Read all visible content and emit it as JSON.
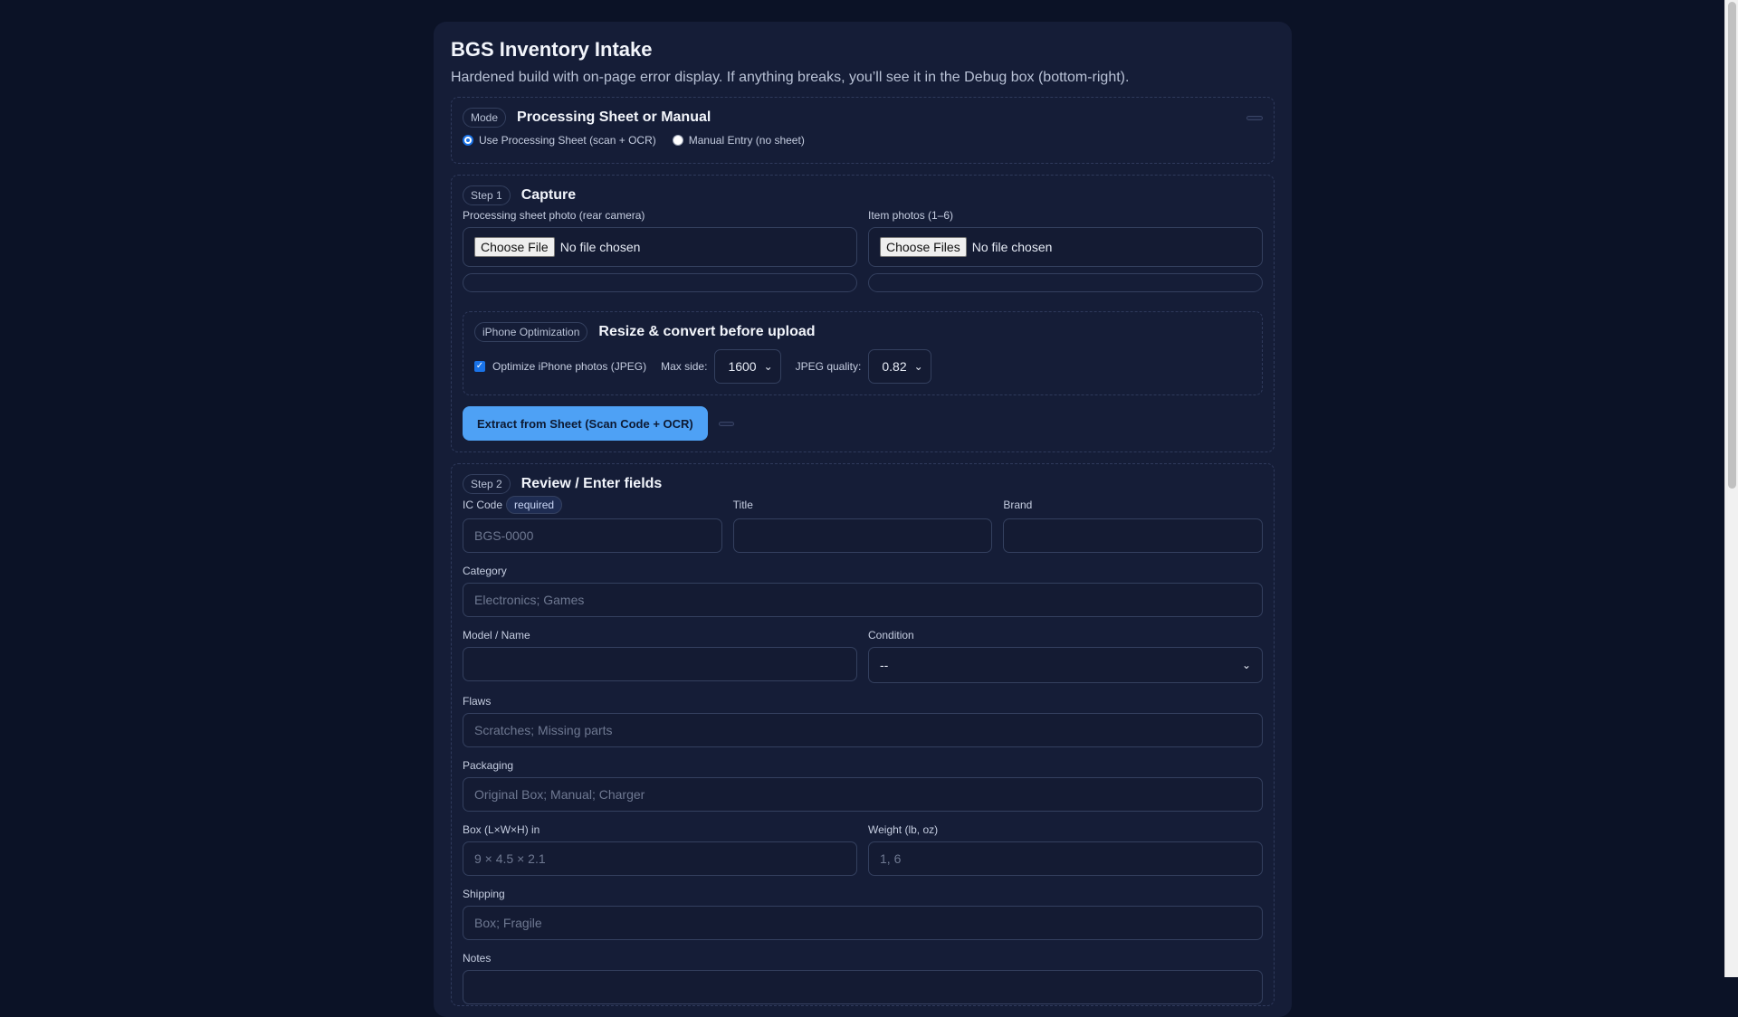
{
  "app": {
    "title": "BGS Inventory Intake",
    "subtitle": "Hardened build with on-page error display. If anything breaks, you’ll see it in the Debug box (bottom-right)."
  },
  "mode": {
    "pill": "Mode",
    "title": "Processing Sheet or Manual",
    "options": [
      {
        "label": "Use Processing Sheet (scan + OCR)",
        "selected": true
      },
      {
        "label": "Manual Entry (no sheet)",
        "selected": false
      }
    ]
  },
  "step1": {
    "pill": "Step 1",
    "title": "Capture",
    "sheet_label": "Processing sheet photo (rear camera)",
    "sheet_button": "Choose File",
    "sheet_status": "No file chosen",
    "items_label": "Item photos (1–6)",
    "items_button": "Choose Files",
    "items_status": "No file chosen",
    "optimization": {
      "pill": "iPhone Optimization",
      "title": "Resize & convert before upload",
      "checkbox_label": "Optimize iPhone photos (JPEG)",
      "checked": true,
      "max_side_label": "Max side:",
      "max_side_value": "1600",
      "quality_label": "JPEG quality:",
      "quality_value": "0.82"
    },
    "extract_button": "Extract from Sheet (Scan Code + OCR)"
  },
  "step2": {
    "pill": "Step 2",
    "title": "Review / Enter fields",
    "ic_code": {
      "label": "IC Code",
      "badge": "required",
      "placeholder": "BGS-0000"
    },
    "title_field": {
      "label": "Title"
    },
    "brand": {
      "label": "Brand"
    },
    "category": {
      "label": "Category",
      "placeholder": "Electronics; Games"
    },
    "model": {
      "label": "Model / Name"
    },
    "condition": {
      "label": "Condition",
      "value": "--"
    },
    "flaws": {
      "label": "Flaws",
      "placeholder": "Scratches; Missing parts"
    },
    "packaging": {
      "label": "Packaging",
      "placeholder": "Original Box; Manual; Charger"
    },
    "box": {
      "label": "Box (L×W×H) in",
      "placeholder": "9 × 4.5 × 2.1"
    },
    "weight": {
      "label": "Weight (lb, oz)",
      "placeholder": "1, 6"
    },
    "shipping": {
      "label": "Shipping",
      "placeholder": "Box; Fragile"
    },
    "notes": {
      "label": "Notes"
    }
  },
  "colors": {
    "background": "#0b1226",
    "card": "#151d37",
    "accent": "#4ea1f5"
  }
}
